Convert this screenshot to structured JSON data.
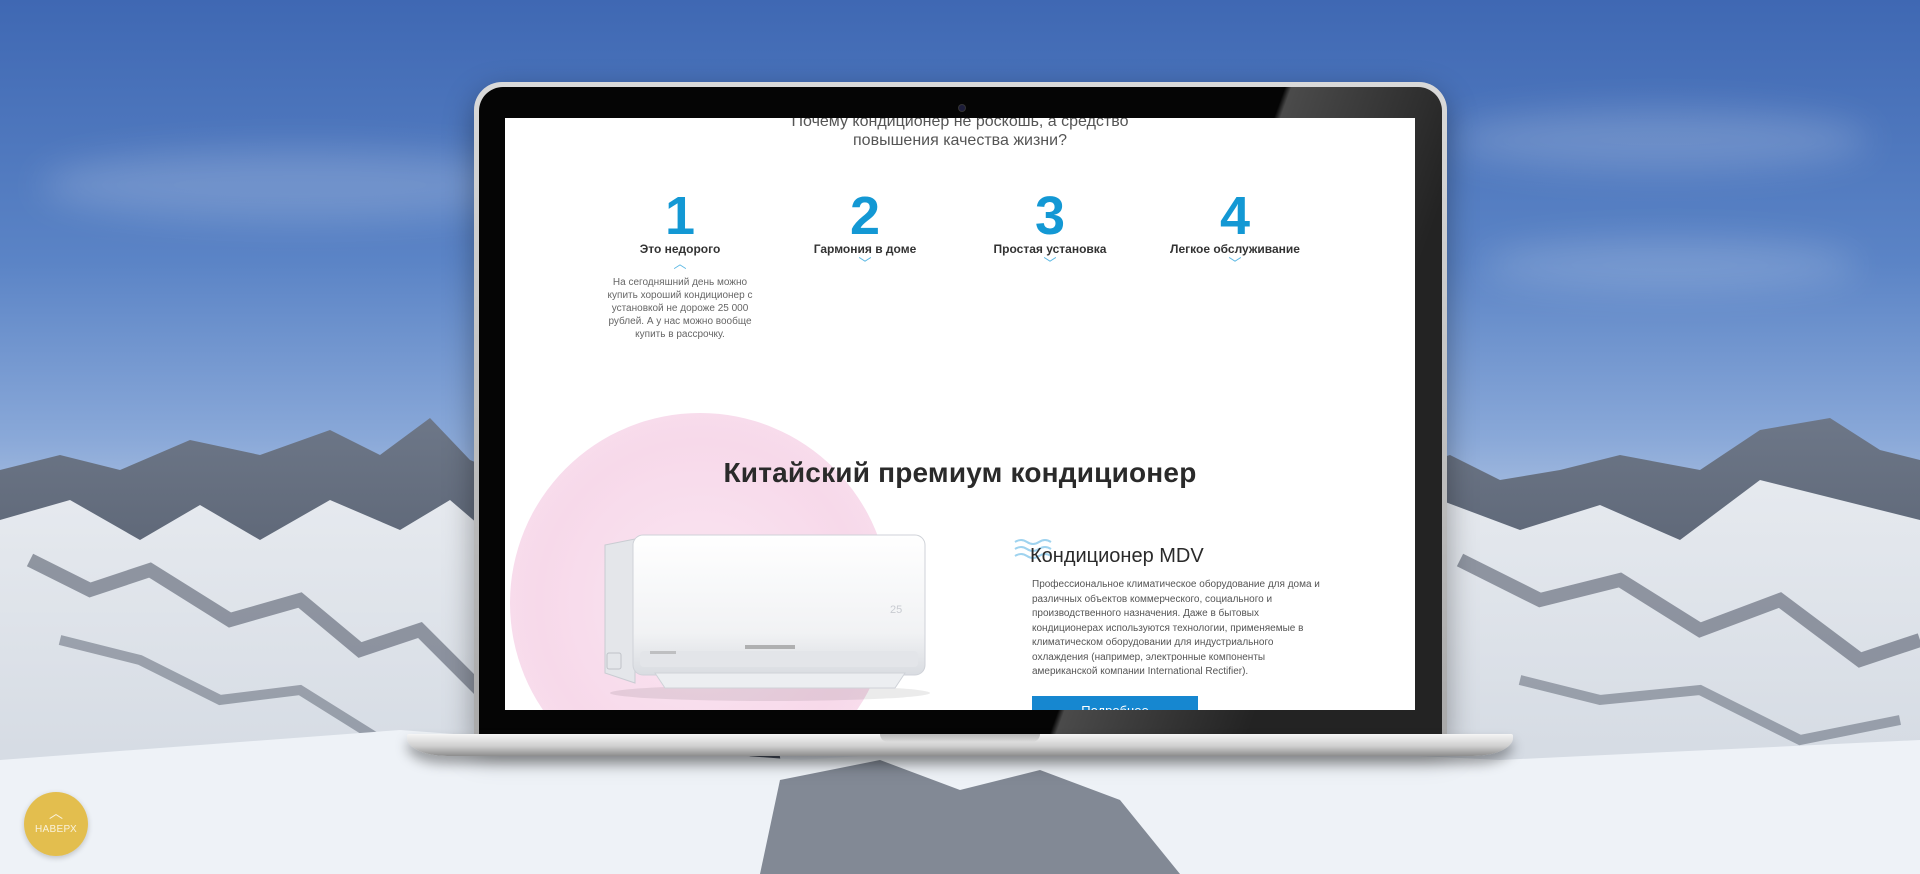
{
  "screen": {
    "lead_line1": "Почему кондиционер не роскошь, а средство",
    "lead_line2": "повышения качества жизни?",
    "steps": [
      {
        "number": "1",
        "title": "Это недорого",
        "expanded": true,
        "description": "На сегодняшний день можно купить хороший кондиционер с установкой не дороже 25 000 рублей. А у нас можно вообще купить в рассрочку."
      },
      {
        "number": "2",
        "title": "Гармония в доме",
        "expanded": false
      },
      {
        "number": "3",
        "title": "Простая установка",
        "expanded": false
      },
      {
        "number": "4",
        "title": "Легкое обслуживание",
        "expanded": false
      }
    ],
    "section_title": "Китайский премиум кондиционер",
    "product": {
      "title": "Кондиционер MDV",
      "description": "Профессиональное климатическое оборудование для дома и различных объектов коммерческого, социального и производственного назначения. Даже в бытовых кондиционерах используются технологии, применяемые в климатическом оборудовании для индустриального охлаждения (например, электронные компоненты американской компании International Rectifier).",
      "cta_label": "Подробнее"
    }
  },
  "back_to_top": {
    "label": "НАВЕРХ"
  },
  "colors": {
    "accent": "#1398d4",
    "button": "#1687d0",
    "back_to_top": "#e0b228"
  },
  "icons": [
    "chevron-up-icon",
    "chevron-down-icon",
    "waves-icon",
    "arrow-up-icon"
  ]
}
